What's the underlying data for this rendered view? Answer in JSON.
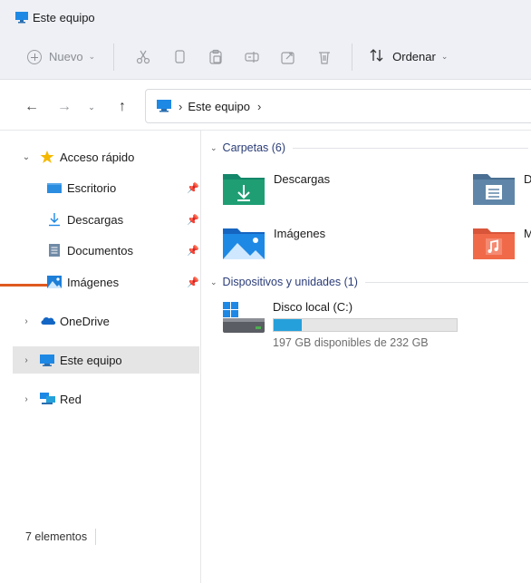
{
  "window": {
    "title": "Este equipo"
  },
  "toolbar": {
    "new_label": "Nuevo",
    "sort_label": "Ordenar",
    "icons": [
      "cut-icon",
      "copy-icon",
      "paste-icon",
      "rename-icon",
      "share-icon",
      "delete-icon"
    ]
  },
  "address": {
    "crumbs": [
      "Este equipo"
    ]
  },
  "sidebar": {
    "items": [
      {
        "label": "Acceso rápido",
        "icon": "star-icon",
        "expanded": true
      },
      {
        "label": "Escritorio",
        "icon": "desktop-folder-icon",
        "pinned": true
      },
      {
        "label": "Descargas",
        "icon": "download-icon",
        "pinned": true
      },
      {
        "label": "Documentos",
        "icon": "document-icon",
        "pinned": true
      },
      {
        "label": "Imágenes",
        "icon": "pictures-icon",
        "pinned": true
      },
      {
        "label": "OneDrive",
        "icon": "cloud-icon",
        "expanded": false
      },
      {
        "label": "Este equipo",
        "icon": "computer-icon",
        "expanded": false,
        "selected": true
      },
      {
        "label": "Red",
        "icon": "network-icon",
        "expanded": false
      }
    ]
  },
  "status": {
    "items_count": "7 elementos"
  },
  "content": {
    "folders_header": "Carpetas (6)",
    "folders": [
      {
        "name": "Descargas",
        "icon": "downloads-folder-icon",
        "color": "#1f9e74"
      },
      {
        "name": "D",
        "icon": "documents-folder-icon",
        "color": "#5f86a8"
      },
      {
        "name": "Imágenes",
        "icon": "pictures-folder-icon",
        "color": "#1e88e5"
      },
      {
        "name": "M",
        "icon": "music-folder-icon",
        "color": "#f06a4a"
      }
    ],
    "devices_header": "Dispositivos y unidades (1)",
    "drive": {
      "name": "Disco local (C:)",
      "info": "197 GB disponibles de 232 GB",
      "used_fraction": 0.151,
      "bar_color": "#26a0da"
    }
  },
  "colors": {
    "accent": "#2b3d78",
    "annotation": "#e0591f",
    "selected_bg": "#e5e5e5"
  }
}
